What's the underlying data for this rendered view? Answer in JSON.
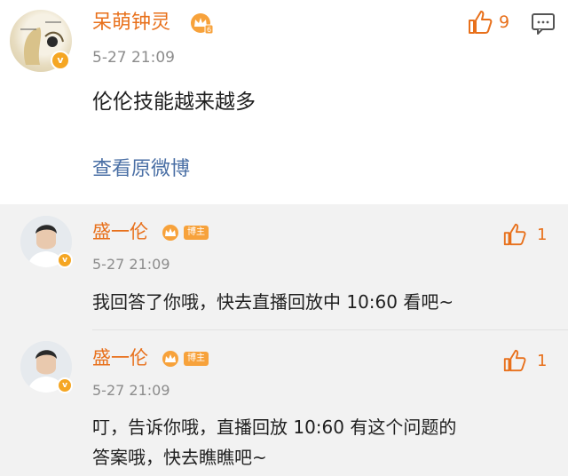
{
  "top_comment": {
    "username": "呆萌钟灵",
    "timestamp": "5-27 21:09",
    "text": "伦伦技能越来越多",
    "link": "查看原微博",
    "like_count": "9",
    "level_badge": "6",
    "verified_mark": "v"
  },
  "replies": [
    {
      "username": "盛一伦",
      "tag": "博主",
      "timestamp": "5-27 21:09",
      "text": "我回答了你哦，快去直播回放中 10:60 看吧~",
      "like_count": "1",
      "verified_mark": "v"
    },
    {
      "username": "盛一伦",
      "tag": "博主",
      "timestamp": "5-27 21:09",
      "text_line1": "叮，告诉你哦，直播回放 10:60 有这个问题的",
      "text_line2": "答案哦，快去瞧瞧吧~",
      "like_count": "1",
      "verified_mark": "v"
    }
  ],
  "colors": {
    "username": "#e8701b",
    "timestamp": "#8c8c8c",
    "link": "#4a6fa5",
    "reply_bg": "#f2f2f2"
  }
}
